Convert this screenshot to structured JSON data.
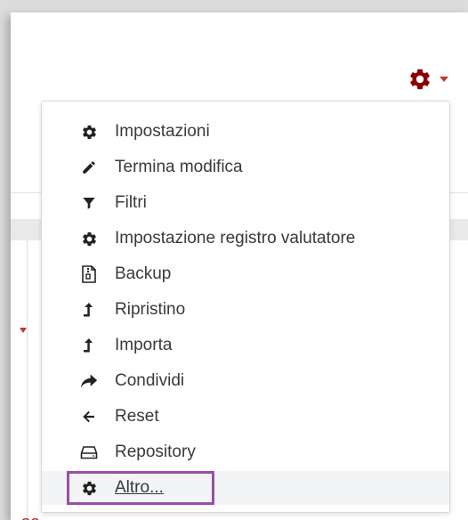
{
  "toolbar": {
    "gear_icon": "gear-icon",
    "gear_color": "#8b0000"
  },
  "menu": {
    "items": [
      {
        "label": "Impostazioni",
        "icon": "gear-icon"
      },
      {
        "label": "Termina modifica",
        "icon": "pencil-icon"
      },
      {
        "label": "Filtri",
        "icon": "filter-icon"
      },
      {
        "label": "Impostazione registro valutatore",
        "icon": "gear-icon"
      },
      {
        "label": "Backup",
        "icon": "file-archive-icon"
      },
      {
        "label": "Ripristino",
        "icon": "upload-arrow-icon"
      },
      {
        "label": "Importa",
        "icon": "upload-arrow-icon"
      },
      {
        "label": "Condividi",
        "icon": "share-icon"
      },
      {
        "label": "Reset",
        "icon": "arrow-left-icon"
      },
      {
        "label": "Repository",
        "icon": "drive-icon"
      },
      {
        "label": "Altro...",
        "icon": "gear-icon"
      }
    ]
  },
  "background": {
    "partial_text": "sa"
  },
  "colors": {
    "accent_red": "#c0392b",
    "highlight_purple": "#9b4ea5",
    "text": "#373a3c"
  }
}
